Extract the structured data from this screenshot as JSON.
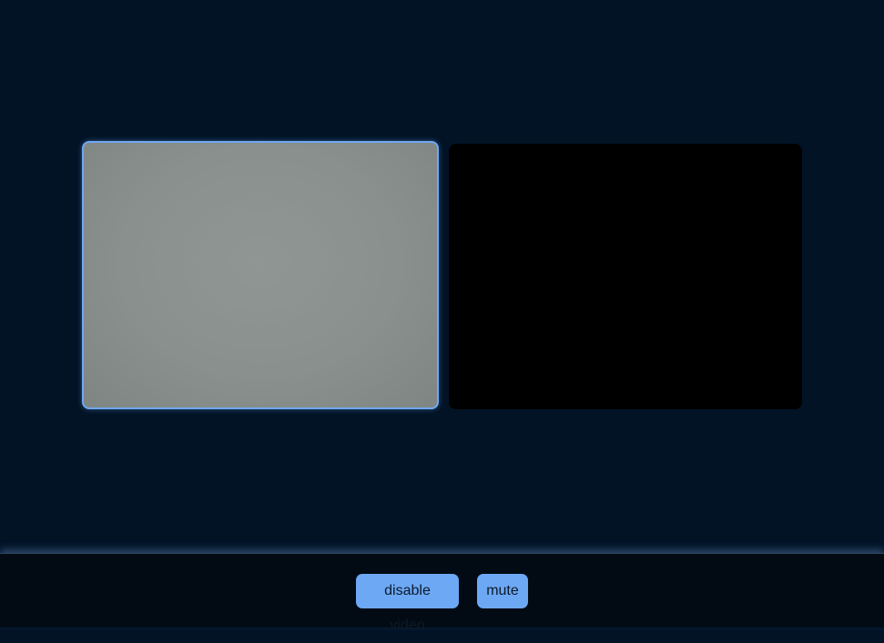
{
  "videos": {
    "local": {
      "label": "local-video",
      "state": "camera-feed"
    },
    "remote": {
      "label": "remote-video",
      "state": "no-feed"
    }
  },
  "controls": {
    "disable_video_label": "disable video",
    "mute_label": "mute"
  },
  "colors": {
    "background": "#021326",
    "control_bar": "#020b14",
    "button": "#6da8f5",
    "local_border": "#6fa8f2",
    "remote_video": "#000000"
  }
}
